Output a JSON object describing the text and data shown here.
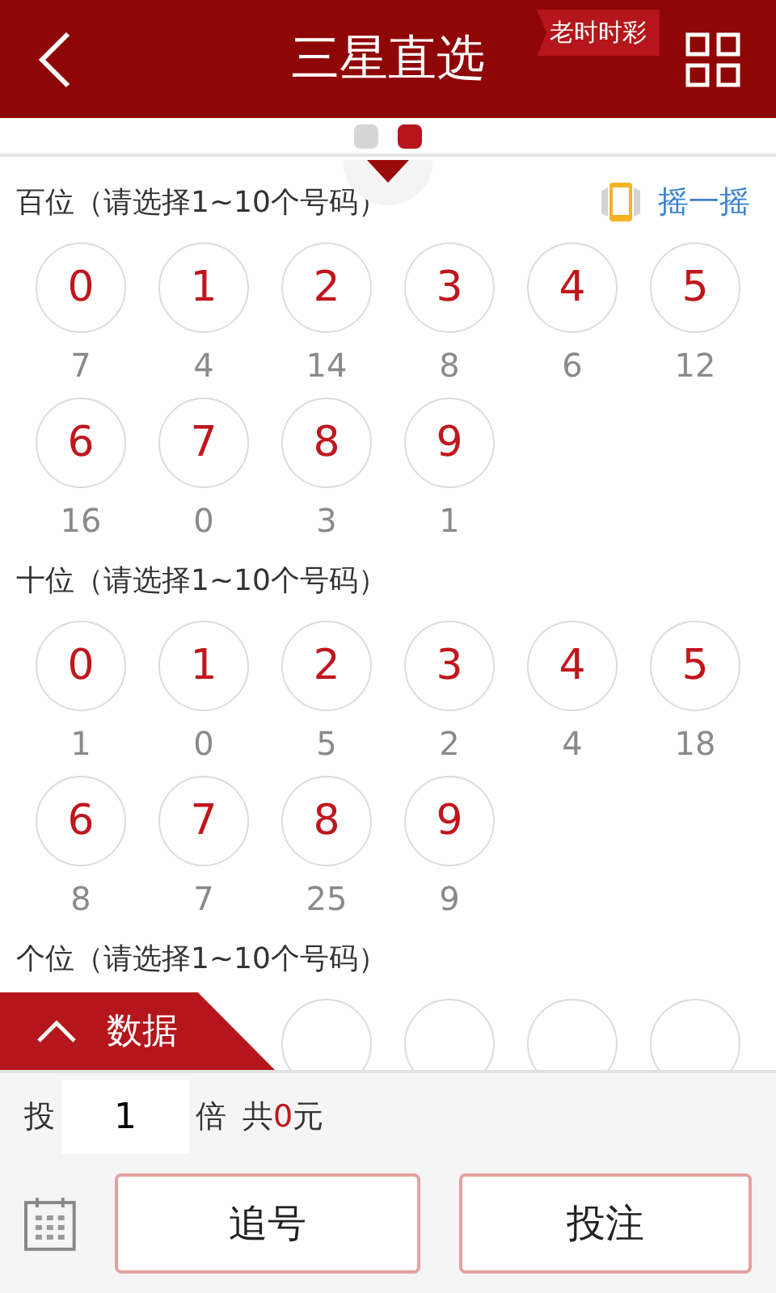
{
  "header": {
    "title": "三星直选",
    "tag": "老时时彩"
  },
  "pager": [
    {
      "selected": false
    },
    {
      "selected": true
    }
  ],
  "shake": {
    "label": "摇一摇"
  },
  "sections": [
    {
      "label": "百位（请选择1~10个号码）",
      "balls": [
        {
          "number": "0",
          "count": "7",
          "selected": false
        },
        {
          "number": "1",
          "count": "4",
          "selected": false
        },
        {
          "number": "2",
          "count": "14",
          "selected": false
        },
        {
          "number": "3",
          "count": "8",
          "selected": false
        },
        {
          "number": "4",
          "count": "6",
          "selected": false
        },
        {
          "number": "5",
          "count": "12",
          "selected": false
        },
        {
          "number": "6",
          "count": "16",
          "selected": false
        },
        {
          "number": "7",
          "count": "0",
          "selected": false
        },
        {
          "number": "8",
          "count": "3",
          "selected": false
        },
        {
          "number": "9",
          "count": "1",
          "selected": false
        }
      ]
    },
    {
      "label": "十位（请选择1~10个号码）",
      "balls": [
        {
          "number": "0",
          "count": "1",
          "selected": false
        },
        {
          "number": "1",
          "count": "0",
          "selected": false
        },
        {
          "number": "2",
          "count": "5",
          "selected": false
        },
        {
          "number": "3",
          "count": "2",
          "selected": false
        },
        {
          "number": "4",
          "count": "4",
          "selected": false
        },
        {
          "number": "5",
          "count": "18",
          "selected": false
        },
        {
          "number": "6",
          "count": "8",
          "selected": false
        },
        {
          "number": "7",
          "count": "7",
          "selected": false
        },
        {
          "number": "8",
          "count": "25",
          "selected": false
        },
        {
          "number": "9",
          "count": "9",
          "selected": false
        }
      ]
    },
    {
      "label": "个位（请选择1~10个号码）",
      "balls": [
        {
          "selected": false
        },
        {
          "selected": false
        },
        {
          "selected": false
        },
        {
          "selected": false
        }
      ]
    }
  ],
  "data_tab": {
    "label": "数据"
  },
  "footer": {
    "multiplier_label": "投",
    "multiplier": "1",
    "times_label": "倍",
    "total_label": "共",
    "total": "0",
    "currency": "元",
    "buttons": [
      "追号",
      "投注"
    ]
  }
}
